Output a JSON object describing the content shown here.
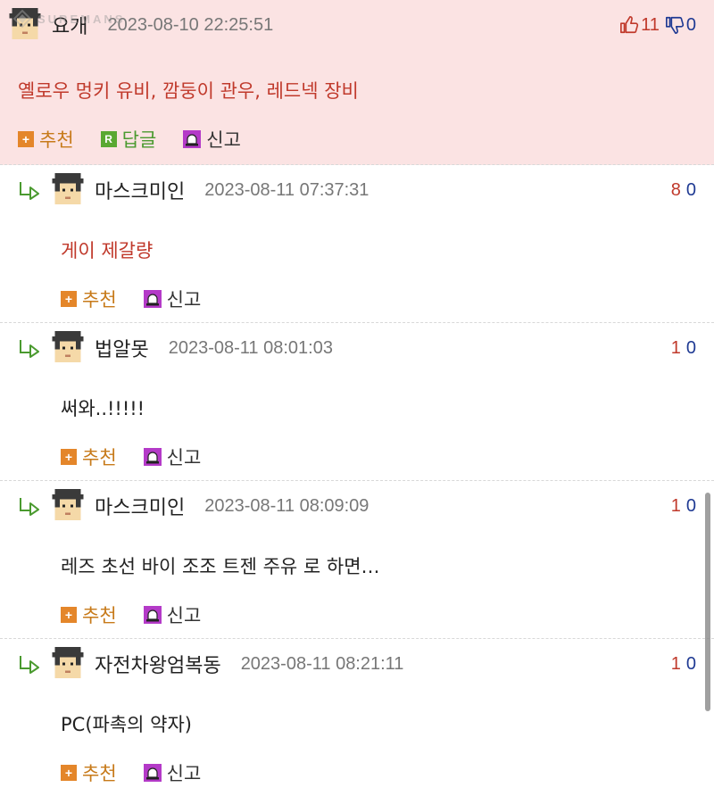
{
  "watermark": {
    "text": "SUREMANS"
  },
  "comments": [
    {
      "nick": "요개",
      "date": "2023-08-10 22:25:51",
      "up": "11",
      "down": "0",
      "body": "옐로우 멍키 유비, 깜둥이 관우, 레드넥 장비",
      "actions": {
        "recommend": "추천",
        "reply": "답글",
        "report": "신고"
      }
    },
    {
      "nick": "마스크미인",
      "date": "2023-08-11 07:37:31",
      "up": "8",
      "down": "0",
      "body": "게이 제갈량",
      "actions": {
        "recommend": "추천",
        "report": "신고"
      }
    },
    {
      "nick": "법알못",
      "date": "2023-08-11 08:01:03",
      "up": "1",
      "down": "0",
      "body": "써와..!!!!!",
      "actions": {
        "recommend": "추천",
        "report": "신고"
      }
    },
    {
      "nick": "마스크미인",
      "date": "2023-08-11 08:09:09",
      "up": "1",
      "down": "0",
      "body": "레즈 초선 바이 조조 트젠 주유 로 하면…",
      "actions": {
        "recommend": "추천",
        "report": "신고"
      }
    },
    {
      "nick": "자전차왕엄복동",
      "date": "2023-08-11 08:21:11",
      "up": "1",
      "down": "0",
      "body": "PC(파촉의 약자)",
      "actions": {
        "recommend": "추천",
        "report": "신고"
      }
    }
  ]
}
